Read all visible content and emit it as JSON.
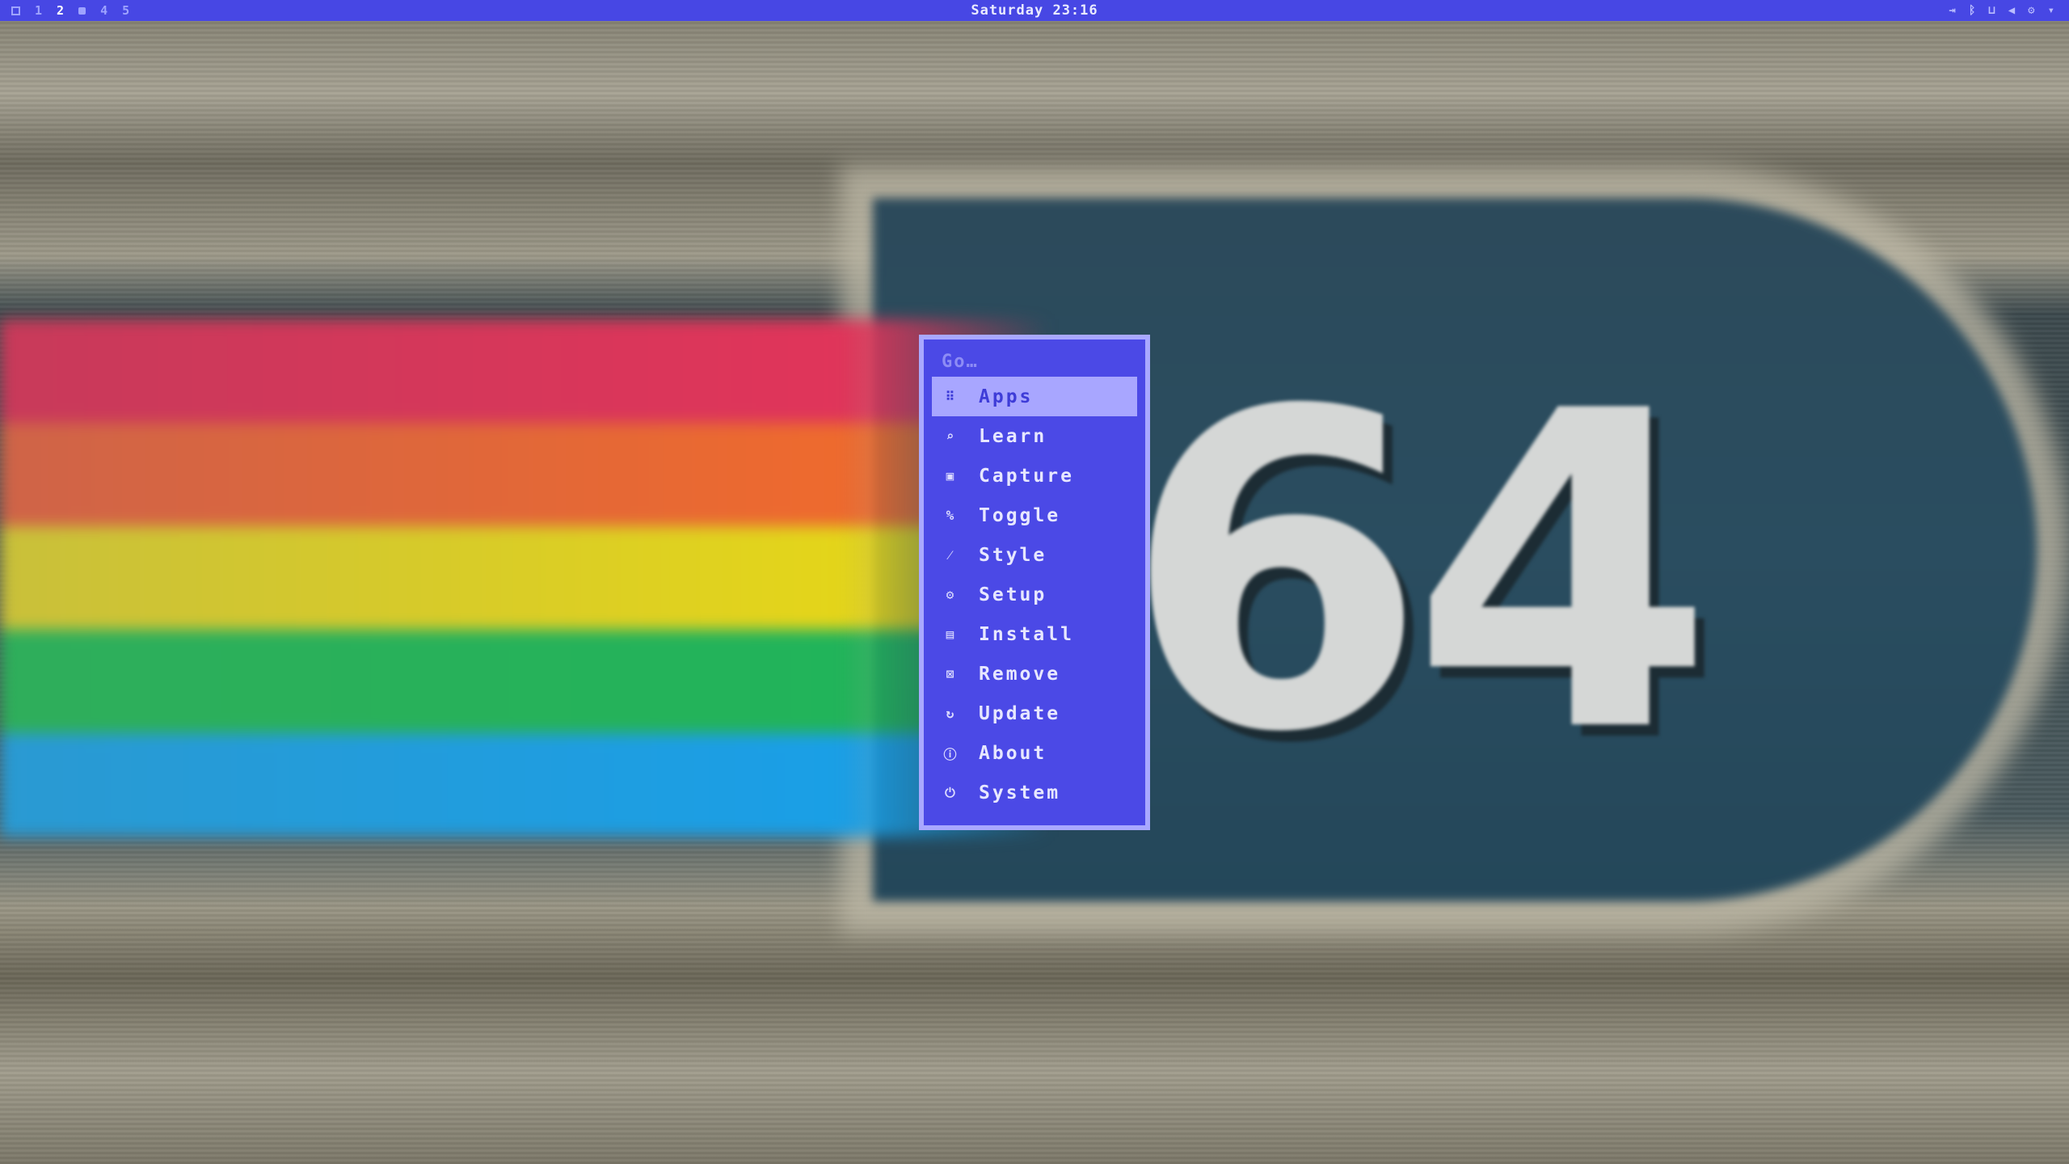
{
  "topbar": {
    "workspaces": [
      "1",
      "2",
      "4",
      "5"
    ],
    "active_workspace": "2",
    "clock": "Saturday 23:16",
    "tray_icons": [
      "exit-icon",
      "bluetooth-icon",
      "network-icon",
      "volume-icon",
      "settings-icon",
      "battery-icon"
    ]
  },
  "launcher": {
    "prompt": "Go…",
    "items": [
      {
        "label": "Apps",
        "icon": "grid-icon",
        "selected": true
      },
      {
        "label": "Learn",
        "icon": "search-icon"
      },
      {
        "label": "Capture",
        "icon": "camera-icon"
      },
      {
        "label": "Toggle",
        "icon": "toggle-icon"
      },
      {
        "label": "Style",
        "icon": "brush-icon"
      },
      {
        "label": "Setup",
        "icon": "gear-icon"
      },
      {
        "label": "Install",
        "icon": "save-icon"
      },
      {
        "label": "Remove",
        "icon": "remove-icon"
      },
      {
        "label": "Update",
        "icon": "refresh-icon"
      },
      {
        "label": "About",
        "icon": "info-icon"
      },
      {
        "label": "System",
        "icon": "power-icon"
      }
    ]
  },
  "wallpaper": {
    "digits": "64"
  },
  "colors": {
    "accent": "#4747e4",
    "selection": "#a8a6ff",
    "menu_bg": "#4b49e6"
  }
}
